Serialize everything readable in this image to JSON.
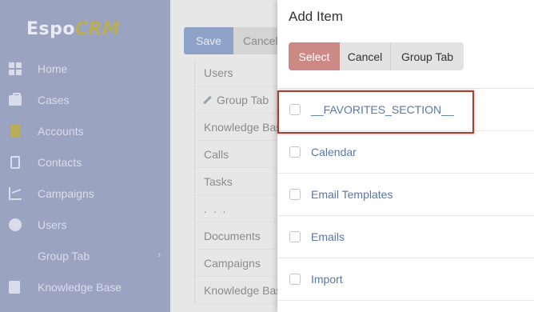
{
  "logo": {
    "part1": "Espo",
    "part2": "CRM"
  },
  "sidebar": {
    "items": [
      {
        "label": "Home",
        "icon": "home-grid-icon"
      },
      {
        "label": "Cases",
        "icon": "briefcase-icon"
      },
      {
        "label": "Accounts",
        "icon": "building-icon"
      },
      {
        "label": "Contacts",
        "icon": "address-card-icon"
      },
      {
        "label": "Campaigns",
        "icon": "chart-line-icon"
      },
      {
        "label": "Users",
        "icon": "user-circle-icon"
      },
      {
        "label": "Group Tab",
        "icon": "chevron-right-icon"
      },
      {
        "label": "Knowledge Base",
        "icon": "book-icon"
      }
    ]
  },
  "toolbar": {
    "save_label": "Save",
    "cancel_label": "Cancel"
  },
  "tab_list": [
    "Users",
    "Group Tab",
    "Knowledge Base",
    "Calls",
    "Tasks",
    ". . .",
    "Documents",
    "Campaigns",
    "Knowledge Base"
  ],
  "modal": {
    "title": "Add Item",
    "buttons": {
      "select": "Select",
      "cancel": "Cancel",
      "group_tab": "Group Tab"
    },
    "items": [
      "__FAVORITES_SECTION__",
      "Calendar",
      "Email Templates",
      "Emails",
      "Import"
    ],
    "highlighted_index": 0
  },
  "colors": {
    "select_button": "#cd8985",
    "link": "#5877a8",
    "highlight_border": "#a8402e",
    "sidebar": "#9aa3c0"
  }
}
